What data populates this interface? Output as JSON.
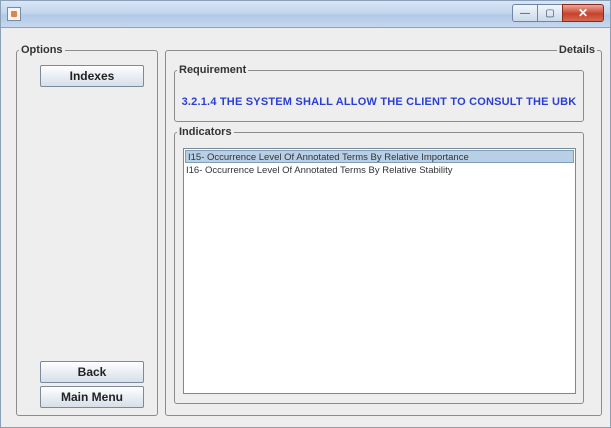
{
  "window": {
    "minimize": "—",
    "maximize": "▢",
    "close": "✕"
  },
  "options": {
    "legend": "Options",
    "indexes_label": "Indexes",
    "back_label": "Back",
    "main_menu_label": "Main Menu"
  },
  "details": {
    "legend": "Details",
    "requirement": {
      "legend": "Requirement",
      "text": "3.2.1.4 THE SYSTEM SHALL ALLOW THE CLIENT TO CONSULT THE UBK"
    },
    "indicators": {
      "legend": "Indicators",
      "items": [
        {
          "label": "I15- Occurrence Level Of Annotated Terms By Relative Importance",
          "selected": true
        },
        {
          "label": "I16- Occurrence Level Of Annotated Terms By Relative Stability",
          "selected": false
        }
      ]
    }
  },
  "colors": {
    "requirement_text": "#2b3fd1",
    "selection": "#b8cfe5",
    "close_button": "#c8412c"
  }
}
